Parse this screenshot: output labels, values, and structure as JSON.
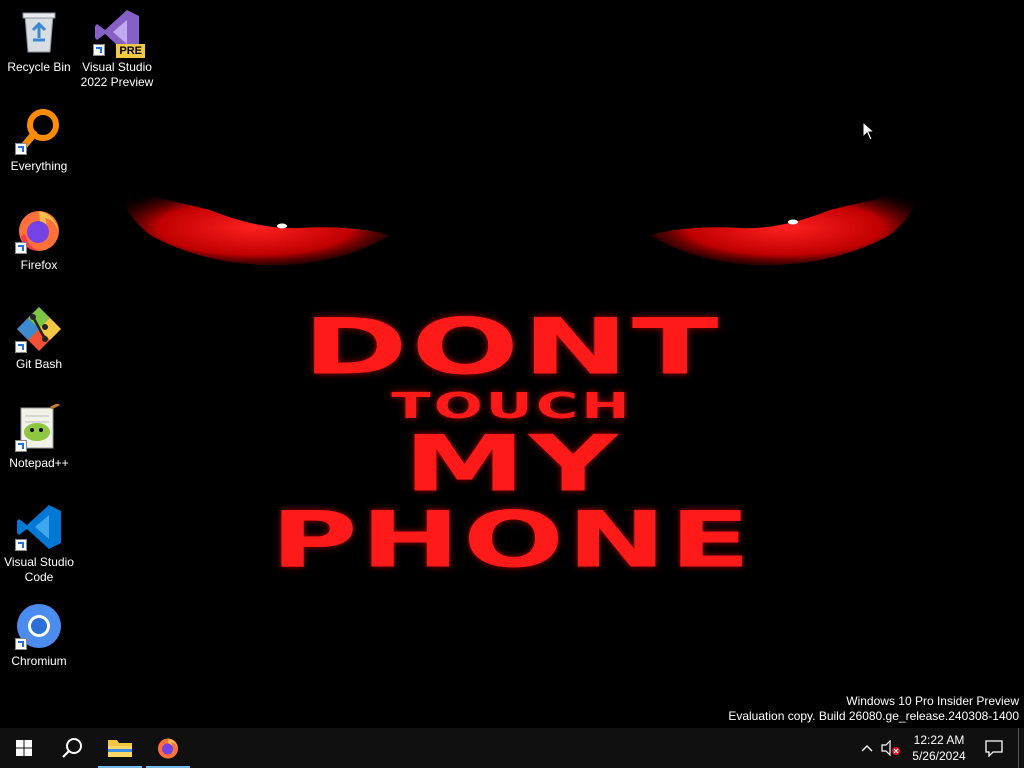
{
  "wallpaper": {
    "line1": "DONT",
    "line2": "TOUCH",
    "line3": "MY",
    "line4": "PHONE"
  },
  "desktop_icons": [
    {
      "label": "Recycle Bin",
      "icon": "recycle-bin-icon"
    },
    {
      "label": "Visual Studio 2022 Preview",
      "icon": "visual-studio-preview-icon",
      "badge": "PRE"
    },
    {
      "label": "Everything",
      "icon": "everything-search-icon"
    },
    {
      "label": "Firefox",
      "icon": "firefox-icon"
    },
    {
      "label": "Git Bash",
      "icon": "git-bash-icon"
    },
    {
      "label": "Notepad++",
      "icon": "notepad-plus-plus-icon"
    },
    {
      "label": "Visual Studio Code",
      "icon": "vscode-icon"
    },
    {
      "label": "Chromium",
      "icon": "chromium-icon"
    }
  ],
  "watermark": {
    "line1": "Windows 10 Pro Insider Preview",
    "line2": "Evaluation copy. Build 26080.ge_release.240308-1400"
  },
  "taskbar": {
    "pinned": [
      {
        "name": "start",
        "icon": "windows-start-icon"
      },
      {
        "name": "search",
        "icon": "search-icon"
      },
      {
        "name": "file-explorer",
        "icon": "folder-icon",
        "active": true
      },
      {
        "name": "firefox",
        "icon": "firefox-icon",
        "active": true
      }
    ],
    "tray": {
      "time": "12:22 AM",
      "date": "5/26/2024"
    }
  },
  "colors": {
    "wallpaper_text": "#ff1a1a",
    "taskbar_bg": "#101010",
    "active_indicator": "#76b9ed"
  }
}
